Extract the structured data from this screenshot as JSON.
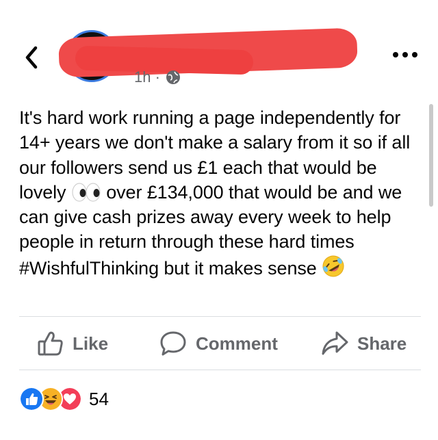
{
  "header": {
    "back_icon": "chevron-left-icon",
    "meta_text": "1h ·",
    "privacy_icon": "globe-icon",
    "more_icon": "more-horizontal-icon"
  },
  "post": {
    "text_segments": [
      "It's hard work running a page independently for 14+ years we don't make a salary from it so if all our followers send us £1 each that would be lovely ",
      " over £134,000 that would be and we can give cash prizes away every week to help people in return through these hard times #WishfulThinking but it makes sense "
    ],
    "emojis": [
      "eyes-emoji",
      "rolling-on-floor-laughing-emoji"
    ]
  },
  "actions": {
    "like_label": "Like",
    "comment_label": "Comment",
    "share_label": "Share"
  },
  "reactions": {
    "icons": [
      "like-reaction-icon",
      "haha-reaction-icon",
      "love-reaction-icon"
    ],
    "count": "54"
  },
  "colors": {
    "muted": "#65676b",
    "like_blue": "#1877f2",
    "love_red": "#f33e58",
    "haha_yellow": "#f7b125",
    "redaction": "#ef4a4a"
  }
}
